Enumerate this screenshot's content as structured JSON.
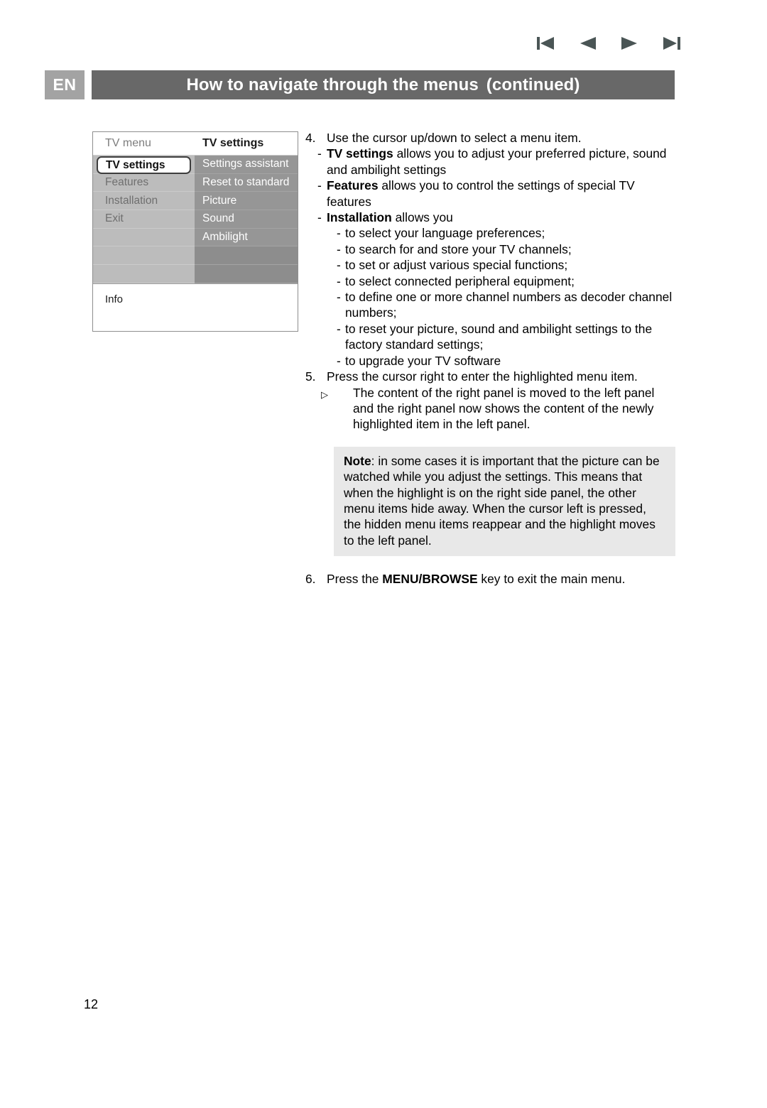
{
  "nav": {
    "icons": [
      {
        "name": "first-page-icon",
        "label": "First"
      },
      {
        "name": "previous-page-icon",
        "label": "Previous"
      },
      {
        "name": "next-page-icon",
        "label": "Next"
      },
      {
        "name": "last-page-icon",
        "label": "Last"
      }
    ],
    "color": "#4a5555"
  },
  "header": {
    "language_badge": "EN",
    "title": "How to navigate through the menus",
    "continued": "(continued)",
    "badge_color": "#a3a3a3",
    "bar_color": "#686868"
  },
  "tv_menu": {
    "left_title": "TV menu",
    "right_title": "TV settings",
    "left_items": [
      {
        "label": "TV settings",
        "highlighted": true
      },
      {
        "label": "Features",
        "highlighted": false
      },
      {
        "label": "Installation",
        "highlighted": false
      },
      {
        "label": "Exit",
        "highlighted": false
      },
      {
        "label": "",
        "highlighted": false
      },
      {
        "label": "",
        "highlighted": false
      },
      {
        "label": "",
        "highlighted": false
      }
    ],
    "right_items": [
      {
        "label": "Settings assistant"
      },
      {
        "label": "Reset to standard"
      },
      {
        "label": "Picture"
      },
      {
        "label": "Sound"
      },
      {
        "label": "Ambilight"
      },
      {
        "label": ""
      },
      {
        "label": ""
      }
    ],
    "info_label": "Info",
    "left_bg_color": "#bcbcbc",
    "right_bg_color": "#969696"
  },
  "content": {
    "step4": {
      "number": "4.",
      "text": "Use the cursor up/down to select a menu item.",
      "dash": "-",
      "items": [
        {
          "bold": "TV settings",
          "rest": " allows you to adjust your preferred picture, sound and ambilight settings"
        },
        {
          "bold": "Features",
          "rest": " allows you to control the settings of special TV features"
        },
        {
          "bold": "Installation",
          "rest": " allows you"
        }
      ],
      "installation_subitems": [
        "to select your language preferences;",
        "to search for and store your TV channels;",
        "to set or adjust various special functions;",
        "to select connected peripheral equipment;",
        "to define one or more channel numbers as decoder channel numbers;",
        "to reset your picture, sound and ambilight settings to the factory standard settings;",
        "to upgrade your TV software"
      ]
    },
    "step5": {
      "number": "5.",
      "text": "Press the cursor right to enter the highlighted menu item.",
      "bullet": "▷",
      "bullet_text": "The content of the right panel is moved to the left panel and the right panel now shows the content of the newly highlighted item in the left panel."
    },
    "note": {
      "label": "Note",
      "separator": ":",
      "text": " in some cases it is important that the picture can be watched while you adjust the settings. This means that when the highlight is on the right side panel, the other menu items hide away. When the cursor left is pressed, the hidden menu items reappear and the highlight moves to the left panel.",
      "bg_color": "#e8e8e8"
    },
    "step6": {
      "number": "6.",
      "text_before": "Press the ",
      "bold": "MENU/BROWSE",
      "text_after": " key to exit the main menu."
    }
  },
  "footer": {
    "page_number": "12"
  }
}
